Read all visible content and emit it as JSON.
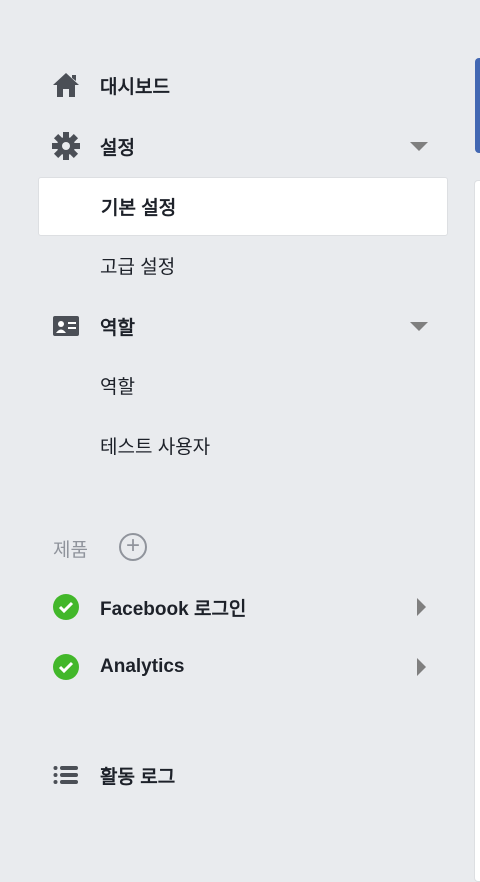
{
  "nav": {
    "dashboard": "대시보드",
    "settings": "설정",
    "settings_basic": "기본 설정",
    "settings_advanced": "고급 설정",
    "roles": "역할",
    "roles_roles": "역할",
    "roles_testers": "테스트 사용자"
  },
  "products": {
    "header": "제품",
    "add": "+",
    "items": [
      {
        "label": "Facebook 로그인",
        "status_color": "#42b72a"
      },
      {
        "label": "Analytics",
        "status_color": "#42b72a"
      }
    ]
  },
  "activity_log": "활동 로그"
}
